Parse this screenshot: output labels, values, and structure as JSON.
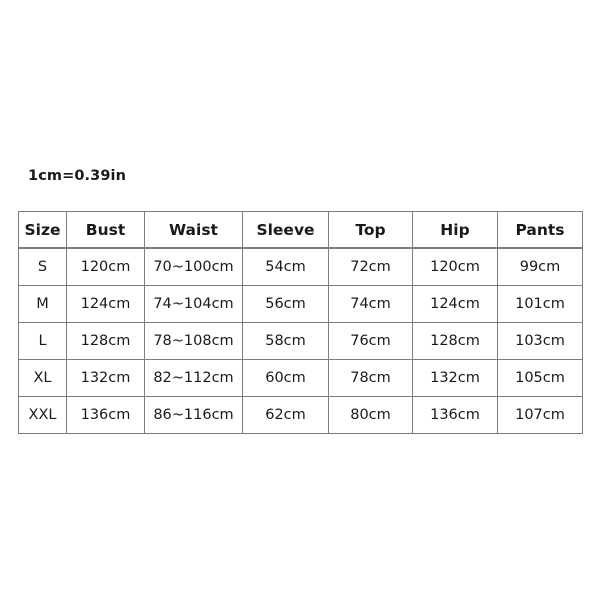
{
  "note": {
    "conversion": "1cm=0.39in"
  },
  "size_chart": {
    "columns": [
      "Size",
      "Bust",
      "Waist",
      "Sleeve",
      "Top",
      "Hip",
      "Pants"
    ],
    "rows": [
      {
        "size": "S",
        "bust": "120cm",
        "waist": "70~100cm",
        "sleeve": "54cm",
        "top": "72cm",
        "hip": "120cm",
        "pants": "99cm"
      },
      {
        "size": "M",
        "bust": "124cm",
        "waist": "74~104cm",
        "sleeve": "56cm",
        "top": "74cm",
        "hip": "124cm",
        "pants": "101cm"
      },
      {
        "size": "L",
        "bust": "128cm",
        "waist": "78~108cm",
        "sleeve": "58cm",
        "top": "76cm",
        "hip": "128cm",
        "pants": "103cm"
      },
      {
        "size": "XL",
        "bust": "132cm",
        "waist": "82~112cm",
        "sleeve": "60cm",
        "top": "78cm",
        "hip": "132cm",
        "pants": "105cm"
      },
      {
        "size": "XXL",
        "bust": "136cm",
        "waist": "86~116cm",
        "sleeve": "62cm",
        "top": "80cm",
        "hip": "136cm",
        "pants": "107cm"
      }
    ]
  },
  "colors": {
    "background": "#ffffff",
    "text": "#1a1a1a",
    "border": "#7d7d7d"
  }
}
